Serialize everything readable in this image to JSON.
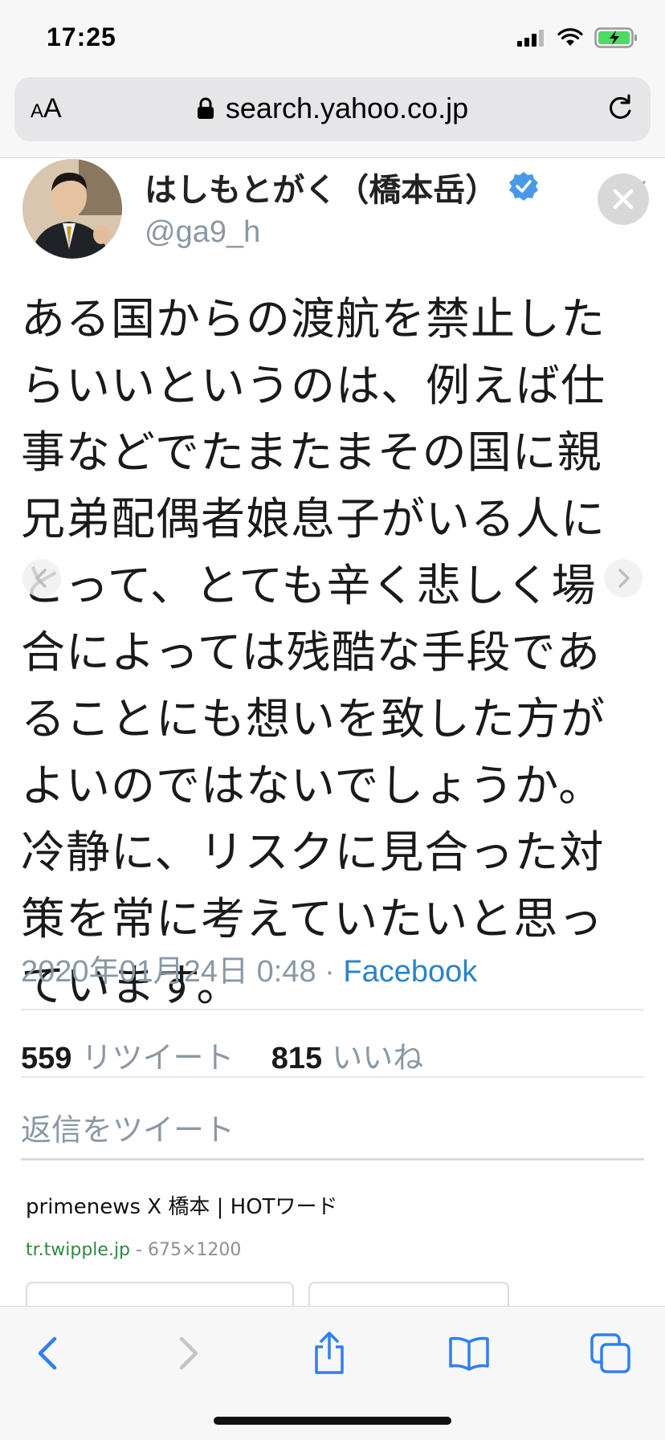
{
  "status": {
    "time": "17:25"
  },
  "browser": {
    "aa_label_small": "A",
    "aa_label": "A",
    "url": "search.yahoo.co.jp"
  },
  "tweet": {
    "author": "はしもとがく（橋本岳）",
    "handle": "@ga9_h",
    "text": "ある国からの渡航を禁止した\nらいいというのは、例えば仕\n事などでたまたまその国に親\n兄弟配偶者娘息子がいる人に\nとって、とても辛く悲しく場\n合によっては残酷な手段であ\nることにも想いを致した方が\nよいのではないでしょうか。\n冷静に、リスクに見合った対\n策を常に考えていたいと思っ\nています。",
    "date": "2020年01月24日 0:48",
    "separator": " · ",
    "source": "Facebook",
    "retweet_count": "559",
    "retweet_label": "リツイート",
    "like_count": "815",
    "like_label": "いいね",
    "reply_placeholder": "返信をツイート"
  },
  "result": {
    "title": "primenews X 橋本 | HOTワード",
    "domain": "tr.twipple.jp",
    "dash": " - ",
    "size": "675×1200"
  },
  "icons": {
    "lock": "lock-icon",
    "reload": "reload-icon",
    "verified": "verified-badge-icon",
    "close": "close-icon",
    "back": "chevron-left-icon",
    "forward": "chevron-right-icon",
    "share": "share-icon",
    "bookmarks": "book-icon",
    "tabs": "tabs-icon"
  },
  "colors": {
    "accent": "#2f7ef5",
    "link": "#2b83c7",
    "verified": "#4a99e9",
    "muted": "#8a98a5",
    "battery": "#4cd964"
  }
}
